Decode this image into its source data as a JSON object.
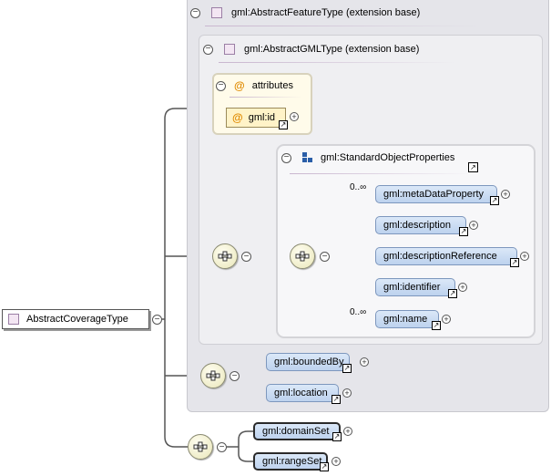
{
  "root": {
    "label": "AbstractCoverageType"
  },
  "abstract_feature_type": {
    "label": "gml:AbstractFeatureType (extension base)"
  },
  "abstract_gml_type": {
    "label": "gml:AbstractGMLType (extension base)"
  },
  "attributes": {
    "header": "attributes",
    "items": [
      "gml:id"
    ]
  },
  "standard_object_properties": {
    "label": "gml:StandardObjectProperties",
    "elements": [
      "gml:metaDataProperty",
      "gml:description",
      "gml:descriptionReference",
      "gml:identifier",
      "gml:name"
    ],
    "cardinality_meta": "0..∞",
    "cardinality_name": "0..∞"
  },
  "feature_elements": [
    "gml:boundedBy",
    "gml:location"
  ],
  "coverage_elements": [
    "gml:domainSet",
    "gml:rangeSet"
  ],
  "icons": {
    "collapse": "minus-circle-icon",
    "expand": "plus-circle-icon",
    "reference": "reference-arrow-icon",
    "sequence": "sequence-compositor-icon",
    "type": "complex-type-icon",
    "attribute": "attribute-icon",
    "group": "group-icon"
  }
}
